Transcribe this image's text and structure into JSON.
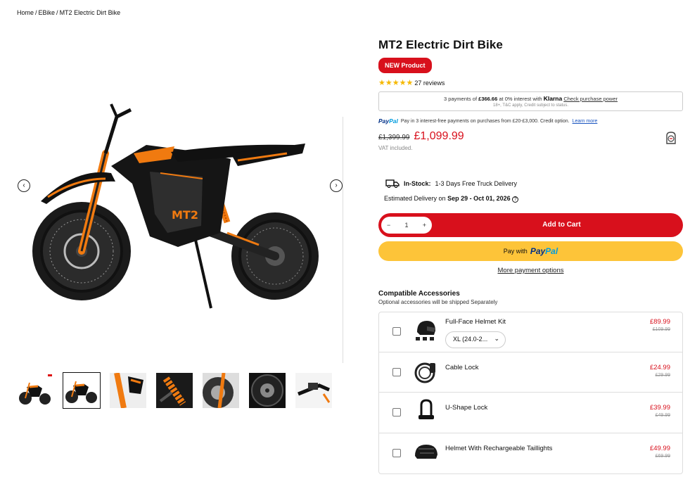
{
  "breadcrumb": {
    "home": "Home",
    "category": "EBike",
    "current": "MT2 Electric Dirt Bike"
  },
  "gallery": {
    "prev_icon": "chevron-left-icon",
    "next_icon": "chevron-right-icon",
    "thumbnail_count": 7,
    "active_thumbnail": 2
  },
  "product": {
    "title": "MT2 Electric Dirt Bike",
    "badge": "NEW Product",
    "rating_stars": "★★★★★",
    "rating": 5,
    "reviews": "27 reviews",
    "old_price": "£1,399.99",
    "price": "£1,099.99",
    "vat": "VAT included."
  },
  "klarna": {
    "prefix": "3 payments of",
    "amount": "£366.66",
    "middle": "at 0% interest with",
    "logo": "Klarna",
    "link": "Check purchase power",
    "disclaimer": "18+, T&C apply, Credit subject to status."
  },
  "paypal_info": {
    "logo_a": "Pay",
    "logo_b": "Pal",
    "text": "Pay in 3 interest-free payments on purchases from £20-£3,000. Credit option.",
    "link": "Learn more"
  },
  "delivery": {
    "stock_label": "In-Stock:",
    "stock_text": "1-3 Days Free Truck Delivery",
    "estimate_prefix": "Estimated Delivery on",
    "estimate_dates": "Sep 29 - Oct 01, 2026",
    "help_icon": "question-circle-icon"
  },
  "cart": {
    "minus": "−",
    "quantity": "1",
    "plus": "+",
    "add_to_cart": "Add to Cart",
    "paypal_prefix": "Pay with",
    "paypal_a": "Pay",
    "paypal_b": "Pal",
    "more_options": "More payment options"
  },
  "accessories": {
    "title": "Compatible Accessories",
    "subtitle": "Optional accessories will be shipped Separately",
    "items": [
      {
        "name": "Full-Face Helmet Kit",
        "price": "£89.99",
        "old_price": "£109.99",
        "size": "XL (24.0-2...",
        "icon": "helmet-kit-icon"
      },
      {
        "name": "Cable Lock",
        "price": "£24.99",
        "old_price": "£29.99",
        "icon": "cable-lock-icon"
      },
      {
        "name": "U-Shape Lock",
        "price": "£39.99",
        "old_price": "£49.99",
        "icon": "u-lock-icon"
      },
      {
        "name": "Helmet With Rechargeable Taillights",
        "price": "£49.99",
        "old_price": "£69.99",
        "icon": "taillight-helmet-icon"
      }
    ]
  },
  "colors": {
    "accent_red": "#d8101c",
    "paypal_yellow": "#fdc439",
    "star": "#f5b800",
    "bike_orange": "#f07a10"
  }
}
